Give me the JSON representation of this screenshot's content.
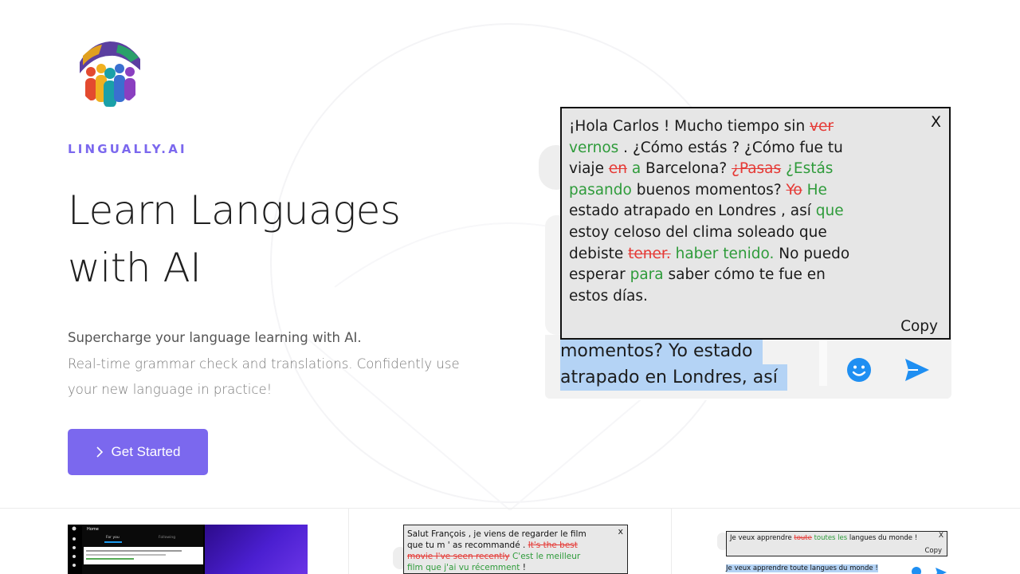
{
  "brand": {
    "name": "LINGUALLY.AI",
    "logo_icon": "people-globe-logo-icon",
    "accent": "#7b68ee"
  },
  "hero": {
    "title_line1": "Learn Languages",
    "title_line2": "with AI",
    "subtitle_lead": "Supercharge your language learning with AI.",
    "subtitle_rest": "Real-time grammar check and translations. Confidently use your new language in practice!",
    "cta_label": "Get Started",
    "cta_icon": "chevron-right-icon"
  },
  "demo": {
    "close_label": "X",
    "copy_label": "Copy",
    "segments": [
      {
        "t": "¡Hola Carlos ! Mucho tiempo sin ",
        "k": "n"
      },
      {
        "t": "ver",
        "k": "del"
      },
      {
        "t": " ",
        "k": "n"
      },
      {
        "t": "vernos",
        "k": "ins"
      },
      {
        "t": " . ¿Cómo estás ? ¿Cómo fue tu viaje ",
        "k": "n"
      },
      {
        "t": "en",
        "k": "del"
      },
      {
        "t": " ",
        "k": "n"
      },
      {
        "t": "a",
        "k": "ins"
      },
      {
        "t": " Barcelona? ",
        "k": "n"
      },
      {
        "t": "¿Pasas",
        "k": "del"
      },
      {
        "t": " ",
        "k": "n"
      },
      {
        "t": "¿Estás pasando",
        "k": "ins"
      },
      {
        "t": " buenos momentos? ",
        "k": "n"
      },
      {
        "t": "Yo",
        "k": "del"
      },
      {
        "t": " ",
        "k": "n"
      },
      {
        "t": "He",
        "k": "ins"
      },
      {
        "t": " estado atrapado en Londres , así ",
        "k": "n"
      },
      {
        "t": "que",
        "k": "ins"
      },
      {
        "t": " estoy celoso del clima soleado que debiste ",
        "k": "n"
      },
      {
        "t": "tener.",
        "k": "del"
      },
      {
        "t": " ",
        "k": "n"
      },
      {
        "t": "haber tenido.",
        "k": "ins"
      },
      {
        "t": " No puedo esperar ",
        "k": "n"
      },
      {
        "t": "para",
        "k": "ins"
      },
      {
        "t": " saber cómo te fue en estos días.",
        "k": "n"
      }
    ],
    "selected_line1": "momentos? Yo estado",
    "selected_line2": "atrapado en Londres, así",
    "emoji_icon": "smiley-icon",
    "send_icon": "send-icon"
  },
  "previews": {
    "twitter": {
      "header": "Home",
      "tab1": "For you",
      "tab2": "Following"
    },
    "french": {
      "close_label": "x",
      "segments": [
        {
          "t": "Salut François , je viens de regarder le film que tu m ' as recommandé . ",
          "k": "n"
        },
        {
          "t": "It's the best movie I've seen recently",
          "k": "del"
        },
        {
          "t": " C'est le meilleur film que j'ai vu récemment",
          "k": "ins"
        },
        {
          "t": " !",
          "k": "n"
        }
      ]
    },
    "langues": {
      "close_label": "X",
      "copy_label": "Copy",
      "segments": [
        {
          "t": "Je veux apprendre ",
          "k": "n"
        },
        {
          "t": "toute",
          "k": "del"
        },
        {
          "t": " ",
          "k": "n"
        },
        {
          "t": "toutes les",
          "k": "ins"
        },
        {
          "t": " langues du monde !",
          "k": "n"
        }
      ],
      "selected": "Je veux apprendre toute langues du monde !"
    }
  }
}
